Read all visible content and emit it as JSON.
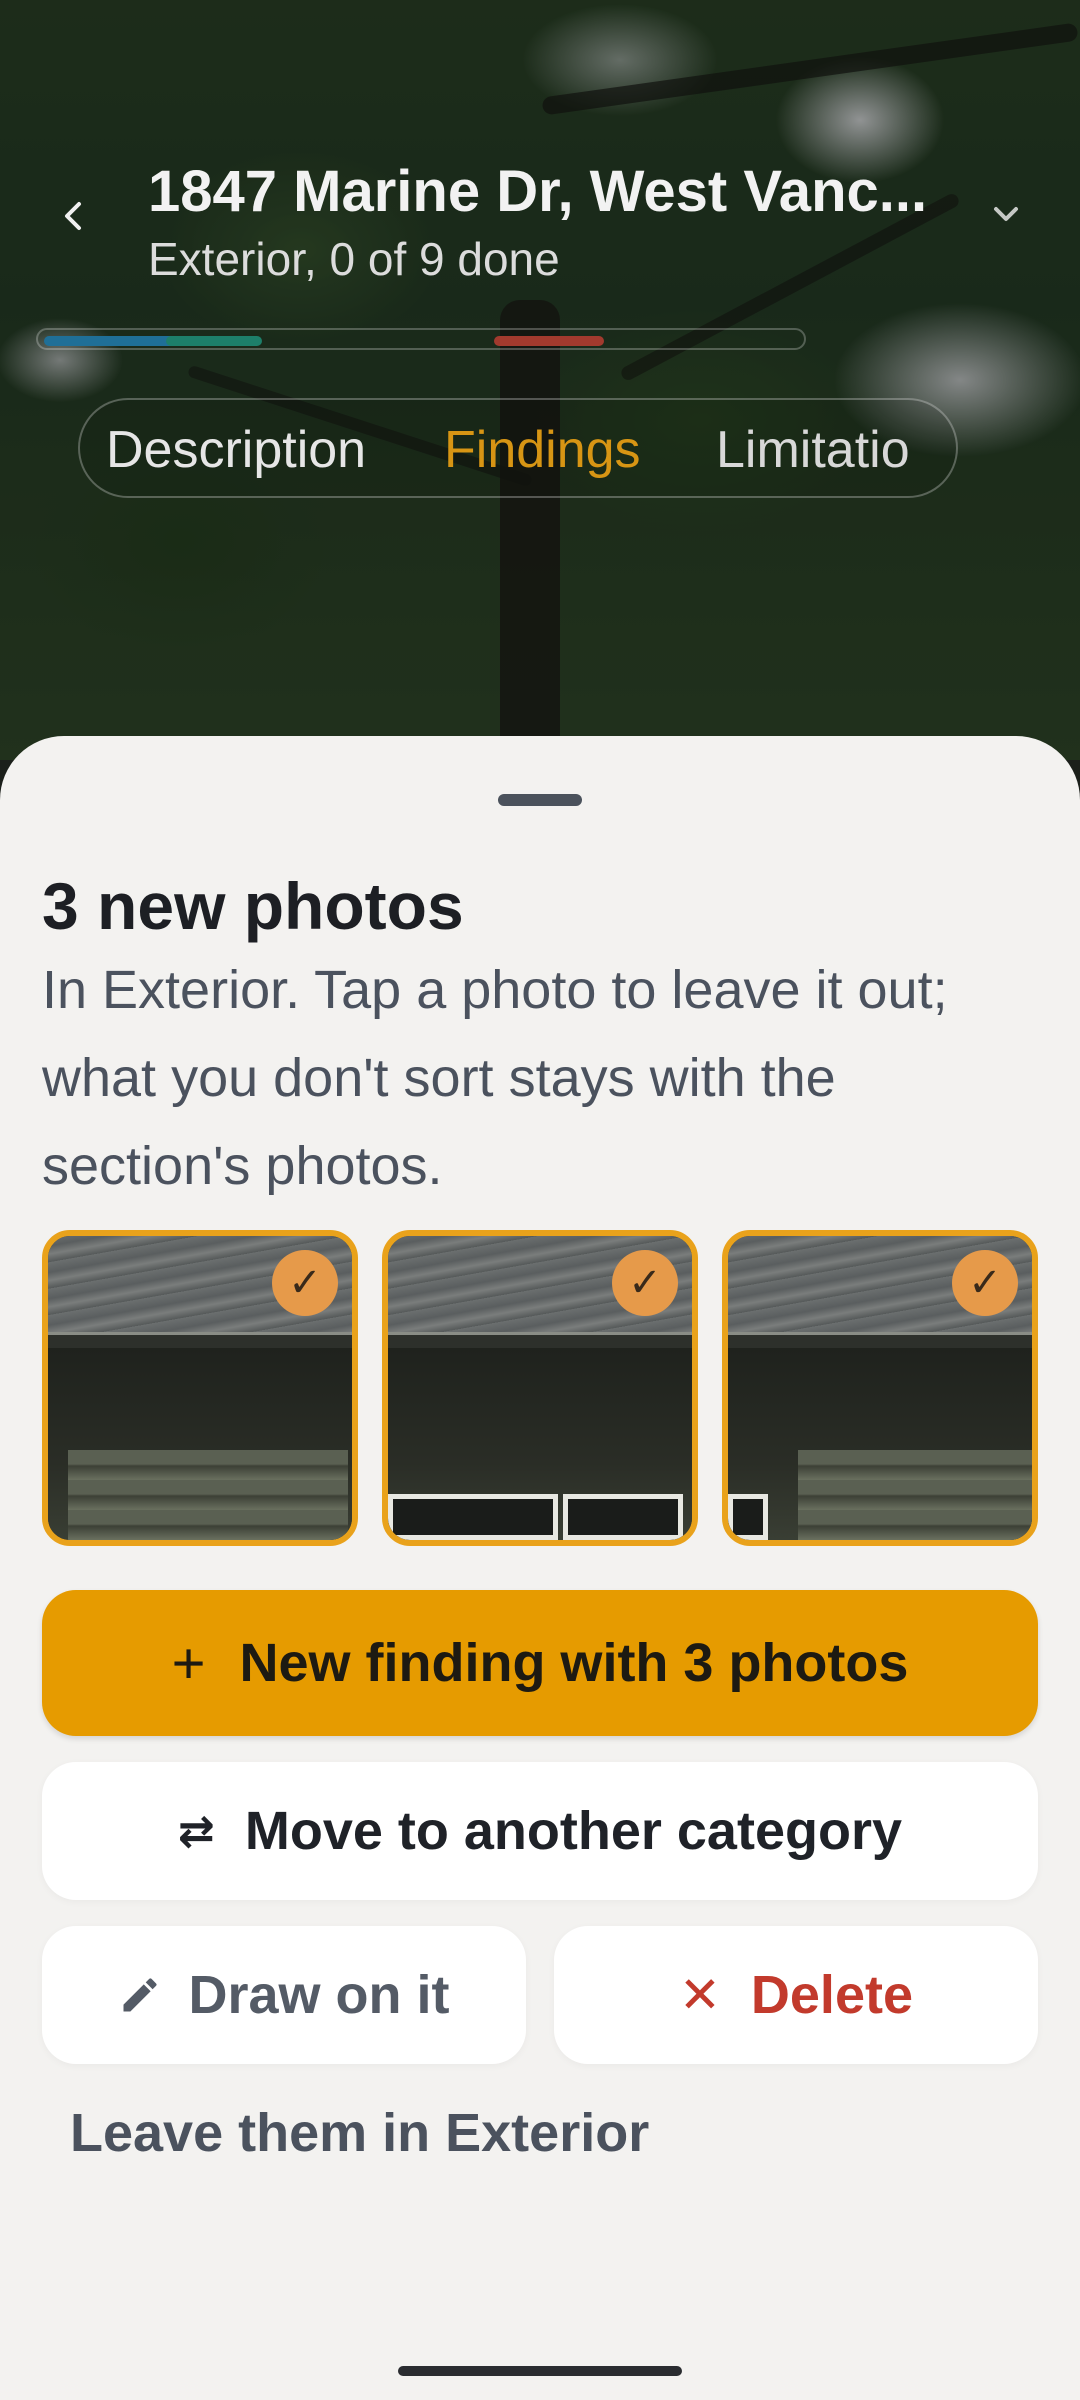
{
  "header": {
    "title": "1847 Marine Dr, West Vanc...",
    "subtitle": "Exterior, 0 of 9 done"
  },
  "progress_segments": [
    {
      "color": "#1f6f97",
      "width_fraction": 0.09
    },
    {
      "color": "#1d7f6a",
      "width_fraction": 0.09
    },
    {
      "color": "#a23a2e",
      "width_fraction": 0.09
    }
  ],
  "tabs": [
    {
      "label": "Description"
    },
    {
      "label": "Findings"
    },
    {
      "label": "Limitatio"
    }
  ],
  "sheet": {
    "title": "3 new photos",
    "description": "In Exterior. Tap a photo to leave it out; what you don't sort stays with the section's photos.",
    "photos": [
      {
        "selected": true,
        "check_icon": "check-icon"
      },
      {
        "selected": true,
        "check_icon": "check-icon"
      },
      {
        "selected": true,
        "check_icon": "check-icon"
      }
    ],
    "primary_button": {
      "label": "New finding with 3 photos",
      "icon": "plus-icon"
    },
    "move_button": {
      "label": "Move to another category",
      "icon": "swap-arrows-icon"
    },
    "draw_button": {
      "label": "Draw on it",
      "icon": "pencil-icon"
    },
    "delete_button": {
      "label": "Delete",
      "icon": "close-icon"
    },
    "leave_link": "Leave them in Exterior"
  },
  "colors": {
    "accent": "#e69b00",
    "photo_border": "#e9a21b",
    "danger": "#c23a2c",
    "tab_active": "#d79514"
  }
}
